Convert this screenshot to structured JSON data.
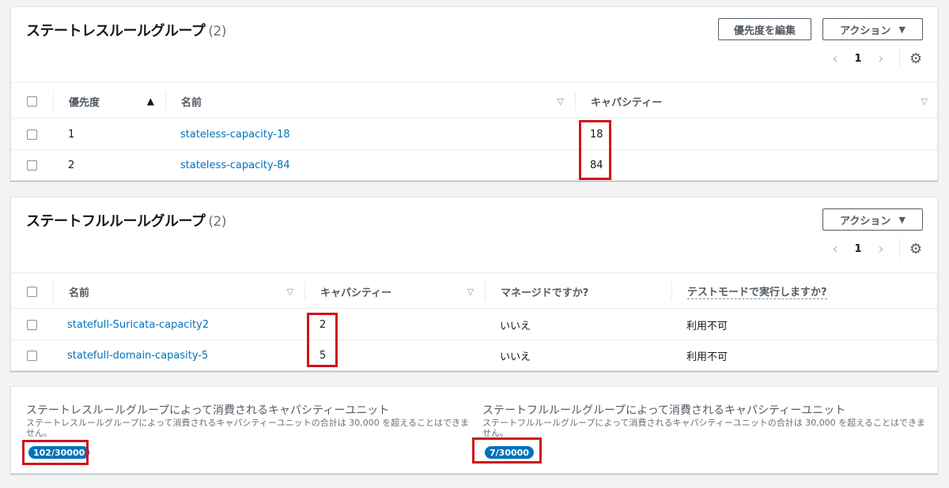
{
  "stateless": {
    "title": "ステートレスルールグループ",
    "count": "(2)",
    "edit_priority_label": "優先度を編集",
    "actions_label": "アクション",
    "page": "1",
    "headers": {
      "priority": "優先度",
      "name": "名前",
      "capacity": "キャパシティー"
    },
    "rows": [
      {
        "priority": "1",
        "name": "stateless-capacity-18",
        "capacity": "18"
      },
      {
        "priority": "2",
        "name": "stateless-capacity-84",
        "capacity": "84"
      }
    ]
  },
  "stateful": {
    "title": "ステートフルルールグループ",
    "count": "(2)",
    "actions_label": "アクション",
    "page": "1",
    "headers": {
      "name": "名前",
      "capacity": "キャパシティー",
      "managed": "マネージドですか?",
      "test_mode": "テストモードで実行しますか?"
    },
    "rows": [
      {
        "name": "statefull-Suricata-capacity2",
        "capacity": "2",
        "managed": "いいえ",
        "test_mode": "利用不可"
      },
      {
        "name": "statefull-domain-capasity-5",
        "capacity": "5",
        "managed": "いいえ",
        "test_mode": "利用不可"
      }
    ]
  },
  "capacity_summary": {
    "stateless": {
      "title": "ステートレスルールグループによって消費されるキャパシティーユニット",
      "desc": "ステートレスルールグループによって消費されるキャパシティーユニットの合計は 30,000 を超えることはできません。",
      "badge": "102/30000"
    },
    "stateful": {
      "title": "ステートフルルールグループによって消費されるキャパシティーユニット",
      "desc": "ステートフルルールグループによって消費されるキャパシティーユニットの合計は 30,000 を超えることはできません。",
      "badge": "7/30000"
    }
  },
  "icons": {
    "chevron_left": "‹",
    "chevron_right": "›",
    "gear": "⚙",
    "caret_down": "▼",
    "sort_asc": "▲",
    "sort_unsorted": "▽"
  },
  "colors": {
    "link": "#0073bb",
    "highlight": "#d0131e",
    "badge": "#0073bb"
  }
}
